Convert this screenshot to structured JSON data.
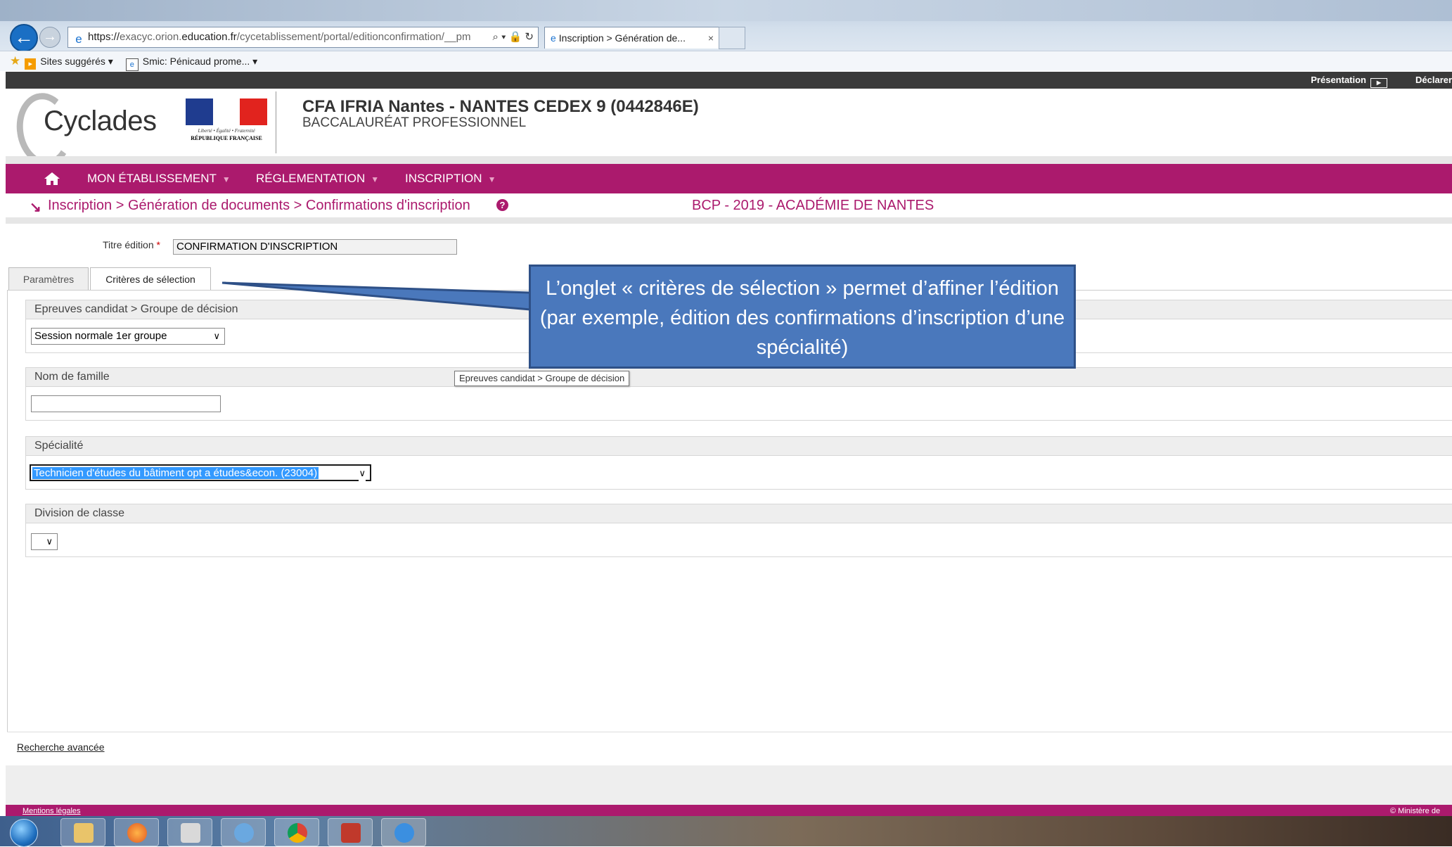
{
  "browser": {
    "url_prefix": "https://",
    "url_dim1": "exacyc.orion.",
    "url_main": "education.fr",
    "url_dim2": "/cycetablissement/portal/editionconfirmation/__pm",
    "url_controls": "⌕ ▾ 🔒 ↻",
    "tab_title": "Inscription > Génération de...",
    "tab_close": "×",
    "favorites": [
      {
        "label": "Sites suggérés ▾"
      },
      {
        "label": "Smic: Pénicaud prome... ▾"
      }
    ]
  },
  "topbar": {
    "presentation": "Présentation",
    "declare": "Déclarer"
  },
  "header": {
    "logo": "Cyclades",
    "motto": "Liberté • Égalité • Fraternité",
    "republique": "RÉPUBLIQUE FRANÇAISE",
    "etablissement": "CFA IFRIA Nantes - NANTES CEDEX 9 (0442846E)",
    "diplome": "BACCALAURÉAT PROFESSIONNEL"
  },
  "nav": {
    "items": [
      {
        "label": "MON ÉTABLISSEMENT"
      },
      {
        "label": "RÉGLEMENTATION"
      },
      {
        "label": "INSCRIPTION"
      }
    ]
  },
  "breadcrumb": {
    "path": "Inscription > Génération de documents > Confirmations d'inscription",
    "help": "?",
    "session": "BCP - 2019 - ACADÉMIE DE NANTES"
  },
  "form": {
    "titre_label": "Titre édition",
    "required_mark": "*",
    "titre_value": "CONFIRMATION D'INSCRIPTION",
    "tabs": [
      {
        "label": "Paramètres"
      },
      {
        "label": "Critères de sélection"
      }
    ],
    "sections": {
      "epreuves": {
        "title": "Epreuves candidat > Groupe de décision",
        "selected": "Session normale 1er groupe"
      },
      "nom": {
        "title": "Nom de famille",
        "value": ""
      },
      "specialite": {
        "title": "Spécialité",
        "selected": "Technicien d'études du bâtiment opt a études&econ. (23004)"
      },
      "division": {
        "title": "Division de classe",
        "selected": ""
      }
    },
    "tooltip": "Epreuves candidat > Groupe de décision",
    "advanced": "Recherche avancée"
  },
  "footer": {
    "mentions": "Mentions légales",
    "ministere": "© Ministère de"
  },
  "callout": {
    "text": "L’onglet  « critères de sélection »  permet d’affiner l’édition (par exemple, édition des confirmations d’inscription d’une spécialité)"
  },
  "colors": {
    "brand": "#ab1a6d",
    "callout": "#4a78bc",
    "selection": "#3399ff"
  },
  "icons": {
    "back": "back-arrow-icon",
    "home": "home-icon",
    "help": "help-icon",
    "chevron": "chevron-down-icon"
  }
}
